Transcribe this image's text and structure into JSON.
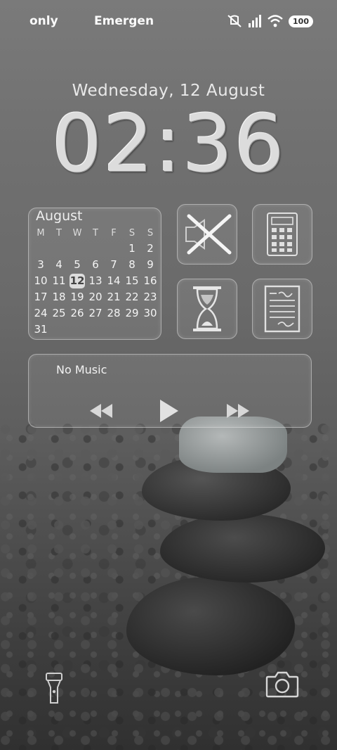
{
  "status_bar": {
    "left_text": "only",
    "center_text": "Emergen",
    "battery": "100"
  },
  "lock": {
    "date": "Wednesday, 12 August",
    "time": "02:36"
  },
  "calendar": {
    "month": "August",
    "weekdays": [
      "M",
      "T",
      "W",
      "T",
      "F",
      "S",
      "S"
    ],
    "today": "12",
    "rows": [
      [
        "",
        "",
        "",
        "",
        "",
        "1",
        "2"
      ],
      [
        "3",
        "4",
        "5",
        "6",
        "7",
        "8",
        "9"
      ],
      [
        "10",
        "11",
        "12",
        "13",
        "14",
        "15",
        "16"
      ],
      [
        "17",
        "18",
        "19",
        "20",
        "21",
        "22",
        "23"
      ],
      [
        "24",
        "25",
        "26",
        "27",
        "28",
        "29",
        "30"
      ],
      [
        "31",
        "",
        "",
        "",
        "",
        "",
        ""
      ]
    ]
  },
  "shortcuts": [
    {
      "icon": "mute-icon"
    },
    {
      "icon": "calculator-icon"
    },
    {
      "icon": "hourglass-icon"
    },
    {
      "icon": "notes-icon"
    }
  ],
  "music": {
    "title": "No Music"
  },
  "bottom": {
    "left_icon": "flashlight-icon",
    "right_icon": "camera-icon"
  }
}
